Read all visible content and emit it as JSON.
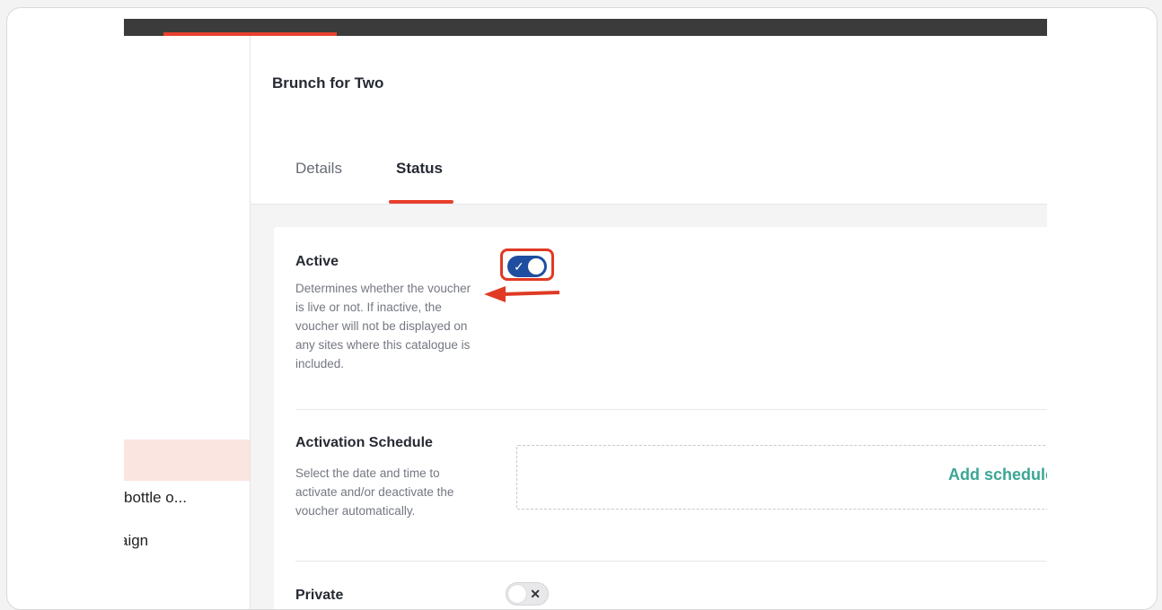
{
  "header": {
    "title": "Brunch for Two"
  },
  "tabs": [
    {
      "label": "Details"
    },
    {
      "label": "Status"
    }
  ],
  "sidebar": {
    "items": [
      {
        "label": "bottle o..."
      },
      {
        "label": "aign"
      }
    ]
  },
  "settings": {
    "active": {
      "title": "Active",
      "description": "Determines whether the voucher is live or not. If inactive, the voucher will not be displayed on any sites where this catalogue is included.",
      "toggle_icon": "✓"
    },
    "schedule": {
      "title": "Activation Schedule",
      "description": "Select the date and time to activate and/or deactivate the voucher automatically.",
      "link_label": "Add schedule"
    },
    "private": {
      "title": "Private",
      "toggle_icon": "✕"
    }
  },
  "colors": {
    "accent": "#e8402e",
    "toggle_on": "#1f4ea0",
    "link": "#3aa694",
    "topbar": "#3b3b3b"
  }
}
